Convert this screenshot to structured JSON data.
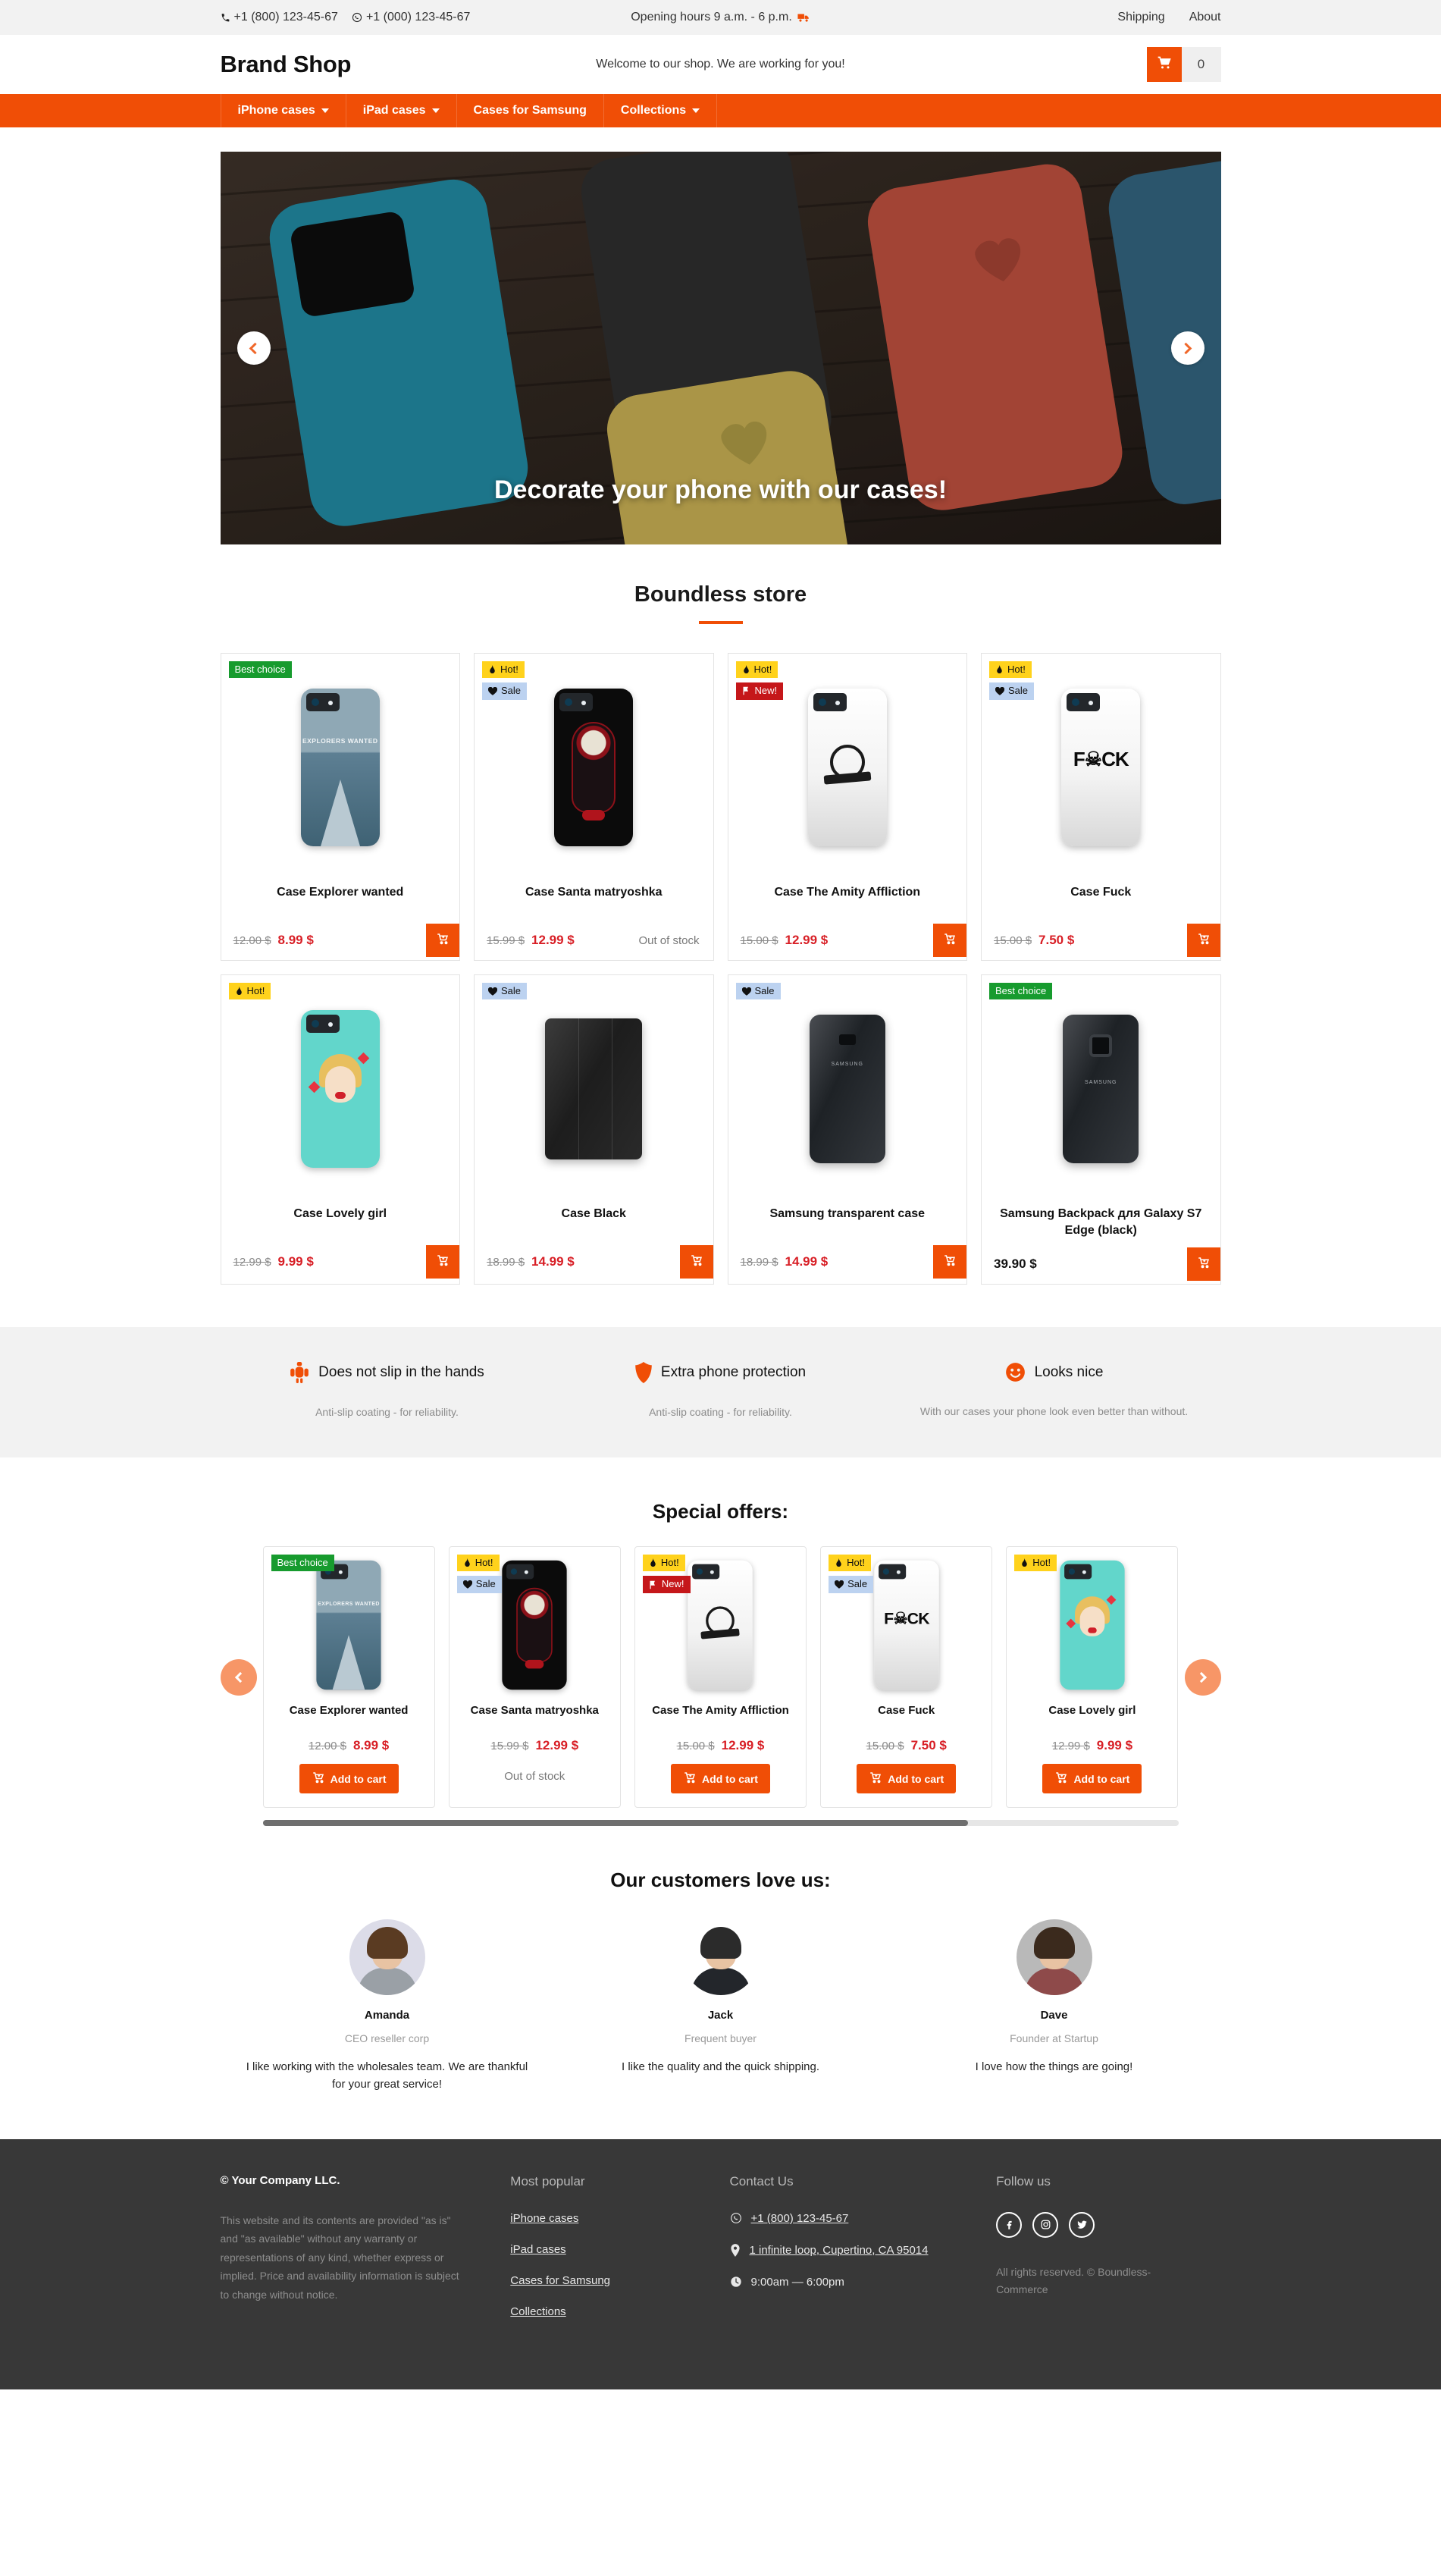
{
  "topbar": {
    "phone1": "+1 (800) 123-45-67",
    "phone2": "+1 (000) 123-45-67",
    "hours": "Opening hours 9 a.m. - 6 p.m.",
    "links": [
      {
        "label": "Shipping"
      },
      {
        "label": "About"
      }
    ]
  },
  "masthead": {
    "brand": "Brand Shop",
    "welcome": "Welcome to our shop. We are working for you!",
    "cart_count": "0"
  },
  "nav": {
    "items": [
      {
        "label": "iPhone cases",
        "caret": true
      },
      {
        "label": "iPad cases",
        "caret": true
      },
      {
        "label": "Cases for Samsung",
        "caret": false
      },
      {
        "label": "Collections",
        "caret": true
      }
    ]
  },
  "hero": {
    "caption": "Decorate your phone with our cases!",
    "prev": "prev-slide",
    "next": "next-slide"
  },
  "catalog": {
    "title": "Boundless store",
    "products": [
      {
        "name": "Case Explorer wanted",
        "labels": [
          {
            "text": "Best choice",
            "kind": "best"
          }
        ],
        "price_old": "12.00 $",
        "price_new": "8.99 $",
        "in_stock": true,
        "art": "explorer"
      },
      {
        "name": "Case Santa matryoshka",
        "labels": [
          {
            "text": "Hot!",
            "kind": "hot"
          },
          {
            "text": "Sale",
            "kind": "sale"
          }
        ],
        "price_old": "15.99 $",
        "price_new": "12.99 $",
        "in_stock": false,
        "stock_text": "Out of stock",
        "art": "matryoshka"
      },
      {
        "name": "Case The Amity Affliction",
        "labels": [
          {
            "text": "Hot!",
            "kind": "hot"
          },
          {
            "text": "New!",
            "kind": "new"
          }
        ],
        "price_old": "15.00 $",
        "price_new": "12.99 $",
        "in_stock": true,
        "art": "amity"
      },
      {
        "name": "Case Fuck",
        "labels": [
          {
            "text": "Hot!",
            "kind": "hot"
          },
          {
            "text": "Sale",
            "kind": "sale"
          }
        ],
        "price_old": "15.00 $",
        "price_new": "7.50 $",
        "in_stock": true,
        "art": "fuck"
      },
      {
        "name": "Case Lovely girl",
        "labels": [
          {
            "text": "Hot!",
            "kind": "hot"
          }
        ],
        "price_old": "12.99 $",
        "price_new": "9.99 $",
        "in_stock": true,
        "art": "lovely"
      },
      {
        "name": "Case Black",
        "labels": [
          {
            "text": "Sale",
            "kind": "sale"
          }
        ],
        "price_old": "18.99 $",
        "price_new": "14.99 $",
        "in_stock": true,
        "art": "tablet"
      },
      {
        "name": "Samsung transparent case",
        "labels": [
          {
            "text": "Sale",
            "kind": "sale"
          }
        ],
        "price_old": "18.99 $",
        "price_new": "14.99 $",
        "in_stock": true,
        "art": "samsung"
      },
      {
        "name": "Samsung Backpack для Galaxy S7 Edge (black)",
        "labels": [
          {
            "text": "Best choice",
            "kind": "best"
          }
        ],
        "price_old": "",
        "price_new": "39.90 $",
        "plain_price": true,
        "in_stock": true,
        "art": "backpack"
      }
    ]
  },
  "features": [
    {
      "icon": "anti-slip-icon",
      "title": "Does not slip in the hands",
      "desc": "Anti-slip coating - for reliability."
    },
    {
      "icon": "shield-icon",
      "title": "Extra phone protection",
      "desc": "Anti-slip coating - for reliability."
    },
    {
      "icon": "smiley-icon",
      "title": "Looks nice",
      "desc": "With our cases your phone look even better than without."
    }
  ],
  "offers": {
    "title": "Special offers:",
    "add_to_cart_label": "Add to cart",
    "out_of_stock_label": "Out of stock",
    "scroll_percent": 77,
    "items": [
      {
        "name": "Case Explorer wanted",
        "labels": [
          {
            "text": "Best choice",
            "kind": "best"
          }
        ],
        "price_old": "12.00 $",
        "price_new": "8.99 $",
        "in_stock": true,
        "art": "explorer"
      },
      {
        "name": "Case Santa matryoshka",
        "labels": [
          {
            "text": "Hot!",
            "kind": "hot"
          },
          {
            "text": "Sale",
            "kind": "sale"
          }
        ],
        "price_old": "15.99 $",
        "price_new": "12.99 $",
        "in_stock": false,
        "art": "matryoshka"
      },
      {
        "name": "Case The Amity Affliction",
        "labels": [
          {
            "text": "Hot!",
            "kind": "hot"
          },
          {
            "text": "New!",
            "kind": "new"
          }
        ],
        "price_old": "15.00 $",
        "price_new": "12.99 $",
        "in_stock": true,
        "art": "amity"
      },
      {
        "name": "Case Fuck",
        "labels": [
          {
            "text": "Hot!",
            "kind": "hot"
          },
          {
            "text": "Sale",
            "kind": "sale"
          }
        ],
        "price_old": "15.00 $",
        "price_new": "7.50 $",
        "in_stock": true,
        "art": "fuck"
      },
      {
        "name": "Case Lovely girl",
        "labels": [
          {
            "text": "Hot!",
            "kind": "hot"
          }
        ],
        "price_old": "12.99 $",
        "price_new": "9.99 $",
        "in_stock": true,
        "art": "lovely"
      }
    ]
  },
  "testimonials": {
    "title": "Our customers love us:",
    "people": [
      {
        "name": "Amanda",
        "role": "CEO reseller corp",
        "text": "I like working with the wholesales team. We are thankful for your great service!"
      },
      {
        "name": "Jack",
        "role": "Frequent buyer",
        "text": "I like the quality and the quick shipping."
      },
      {
        "name": "Dave",
        "role": "Founder at Startup",
        "text": "I love how the things are going!"
      }
    ]
  },
  "footer": {
    "company": "© Your Company LLC.",
    "legal": "This website and its contents are provided \"as is\" and \"as available\" without any warranty or representations of any kind, whether express or implied. Price and availability information is subject to change without notice.",
    "popular_heading": "Most popular",
    "popular_links": [
      {
        "label": "iPhone cases"
      },
      {
        "label": "iPad cases"
      },
      {
        "label": "Cases for Samsung"
      },
      {
        "label": "Collections"
      }
    ],
    "contact_heading": "Contact Us",
    "contact_phone": "+1 (800) 123-45-67",
    "contact_address": "1 infinite loop, Cupertino, CA 95014",
    "contact_hours": "9:00am — 6:00pm",
    "follow_heading": "Follow us",
    "socials": [
      {
        "name": "facebook-icon"
      },
      {
        "name": "instagram-icon"
      },
      {
        "name": "twitter-icon"
      }
    ],
    "rights": "All rights reserved. © Boundless-Commerce"
  },
  "colors": {
    "accent": "#f04e06",
    "accent_soft": "#f79667",
    "best": "#179b2e",
    "hot": "#ffd21c",
    "sale": "#bcd2f0",
    "new": "#c5171a",
    "price_new": "#d81f26",
    "footer_bg": "#383838"
  }
}
